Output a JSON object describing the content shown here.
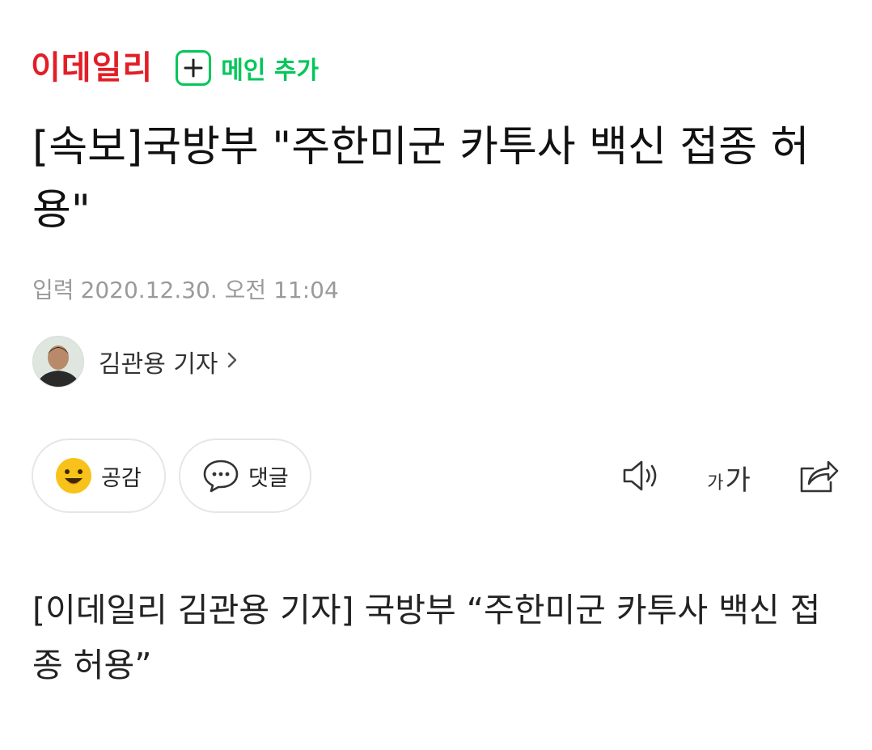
{
  "header": {
    "logo_text": "이데일리",
    "main_add_label": "메인 추가",
    "brand_color": "#e21e26",
    "accent_color": "#03c75a"
  },
  "article": {
    "headline": "[속보]국방부 \"주한미군 카투사 백신 접종 허용\"",
    "date_label": "입력",
    "date_value": "2020.12.30. 오전 11:04",
    "reporter_name": "김관용 기자",
    "body": "[이데일리 김관용 기자] 국방부 “주한미군 카투사 백신 접종 허용”"
  },
  "actions": {
    "empathy_label": "공감",
    "comment_label": "댓글",
    "font_small": "가",
    "font_large": "가"
  },
  "icons": {
    "plus": "plus-icon",
    "empathy": "smiley-icon",
    "comment": "speech-bubble-icon",
    "audio": "speaker-icon",
    "share": "share-icon",
    "chevron": "chevron-right-icon"
  }
}
